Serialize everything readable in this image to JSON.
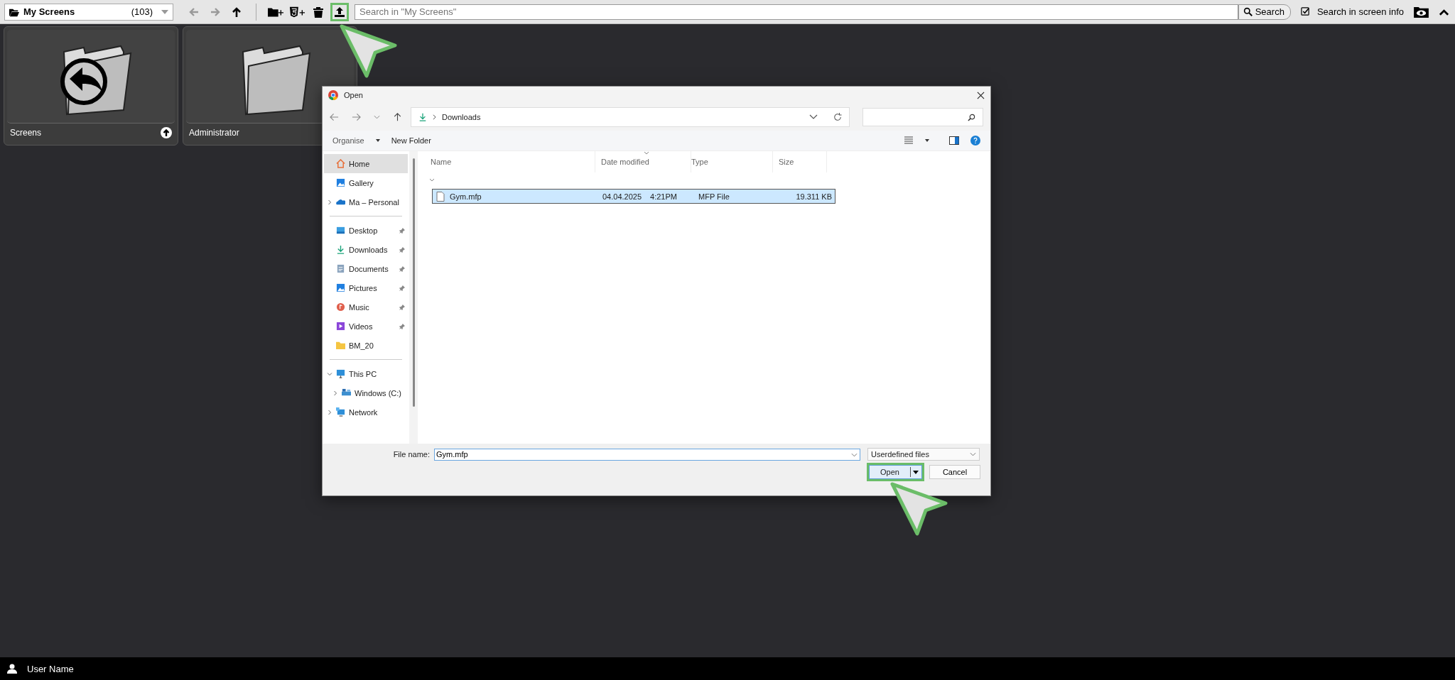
{
  "toolbar": {
    "folder": "My Screens",
    "count": "(103)",
    "tools": [
      {
        "kind": "back",
        "disabled": true,
        "highlighted": false
      },
      {
        "kind": "forward",
        "disabled": true,
        "highlighted": false
      },
      {
        "kind": "up",
        "disabled": false,
        "highlighted": false
      },
      {
        "kind": "new-folder",
        "disabled": false,
        "highlighted": false
      },
      {
        "kind": "new-html",
        "disabled": false,
        "highlighted": false
      },
      {
        "kind": "delete",
        "disabled": false,
        "highlighted": false
      },
      {
        "kind": "upload",
        "disabled": false,
        "highlighted": true
      }
    ],
    "search_placeholder": "Search in \"My Screens\"",
    "search_button": "Search",
    "search_info": {
      "label": "Search in screen info",
      "checked": true
    }
  },
  "tiles": [
    {
      "label": "Screens",
      "kind": "parent"
    },
    {
      "label": "Administrator",
      "kind": "folder"
    }
  ],
  "dialog": {
    "title": "Open",
    "path": "Downloads",
    "commands": [
      "Organise",
      "New Folder"
    ],
    "sidebar": [
      [
        {
          "label": "Home",
          "selected": true
        },
        {
          "label": "Gallery",
          "selected": false
        },
        {
          "label": "Ma – Personal",
          "selected": false,
          "expanded": false
        }
      ],
      [
        {
          "label": "Desktop",
          "selected": false,
          "pinned": true
        },
        {
          "label": "Downloads",
          "selected": false,
          "pinned": true
        },
        {
          "label": "Documents",
          "selected": false,
          "pinned": true
        },
        {
          "label": "Pictures",
          "selected": false,
          "pinned": true
        },
        {
          "label": "Music",
          "selected": false,
          "pinned": true
        },
        {
          "label": "Videos",
          "selected": false,
          "pinned": true
        },
        {
          "label": "BM_20",
          "selected": false,
          "pinned": false
        }
      ],
      [
        {
          "label": "This PC",
          "selected": false,
          "expanded": true,
          "children": [
            {
              "label": "Windows (C:)",
              "selected": false,
              "expanded": false
            }
          ]
        },
        {
          "label": "Network",
          "selected": false,
          "expanded": false
        }
      ]
    ],
    "columns": [
      "Name",
      "Date modified",
      "Type",
      "Size"
    ],
    "files": [
      {
        "name": "Gym.mfp",
        "date": "04.04.2025",
        "time": "4:21PM",
        "type": "MFP File",
        "size": "19.311 KB",
        "selected": true
      }
    ],
    "file_name_label": "File name:",
    "file_name": "Gym.mfp",
    "file_type": "Userdefined files",
    "buttons": [
      {
        "label": "Open",
        "kind": "primary",
        "highlighted": true
      },
      {
        "label": "Cancel",
        "kind": "secondary",
        "highlighted": false
      }
    ]
  },
  "status_bar": {
    "user": "User Name"
  }
}
